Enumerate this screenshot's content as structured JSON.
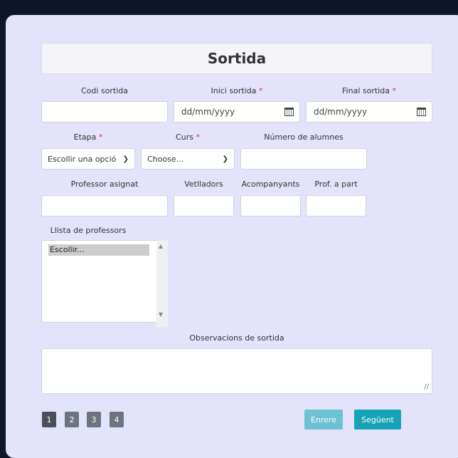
{
  "form": {
    "title": "Sortida",
    "labels": {
      "codi": "Codi sortida",
      "inici": "Inici sortida",
      "final": "Final sortida",
      "etapa": "Etapa",
      "curs": "Curs",
      "num_alumnes": "Número de alumnes",
      "professor": "Professor asignat",
      "vetlladors": "Vetlladors",
      "acompanyants": "Acompanyants",
      "prof_part": "Prof. a part",
      "llista": "Llista de professors",
      "observacions": "Observacions de sortida"
    },
    "required_mark": "*",
    "date_placeholder": "dd/mm/yyyy",
    "etapa_value": "Escollir una opció",
    "curs_value": "Choose...",
    "list_options": [
      "Escollir..."
    ]
  },
  "pagination": {
    "pages": [
      "1",
      "2",
      "3",
      "4"
    ],
    "active": "1"
  },
  "buttons": {
    "prev": "Enrere",
    "next": "Següent"
  },
  "colors": {
    "accent": "#17a2b8",
    "required": "#dc3545",
    "card_bg": "#e3e3fb",
    "page_bg": "#0e1628"
  }
}
